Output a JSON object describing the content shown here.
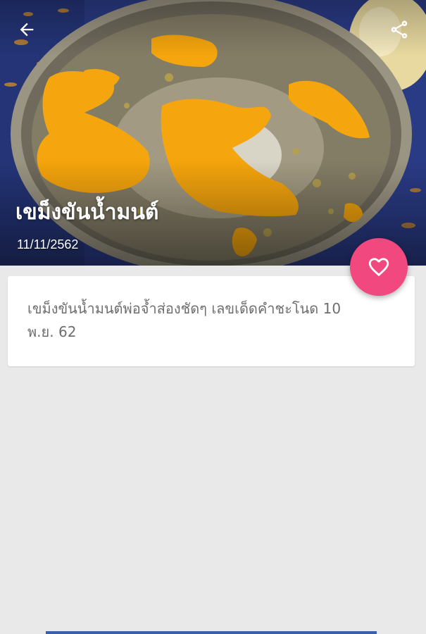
{
  "header": {
    "title": "เขม็งขันน้ำมนต์",
    "date": "11/11/2562",
    "back_icon": "arrow-left-icon",
    "share_icon": "share-icon"
  },
  "favorite": {
    "icon": "heart-outline-icon",
    "color": "#f0487f"
  },
  "content": {
    "description": "เขม็งขันน้ำมนต์พ่อจ้ำส่องชัดๆ เลขเด็ดคำชะโนด 10 พ.ย. 62"
  },
  "colors": {
    "background": "#e9e9e9",
    "card": "#ffffff",
    "accent": "#f0487f",
    "text": "#6e6e6e"
  }
}
